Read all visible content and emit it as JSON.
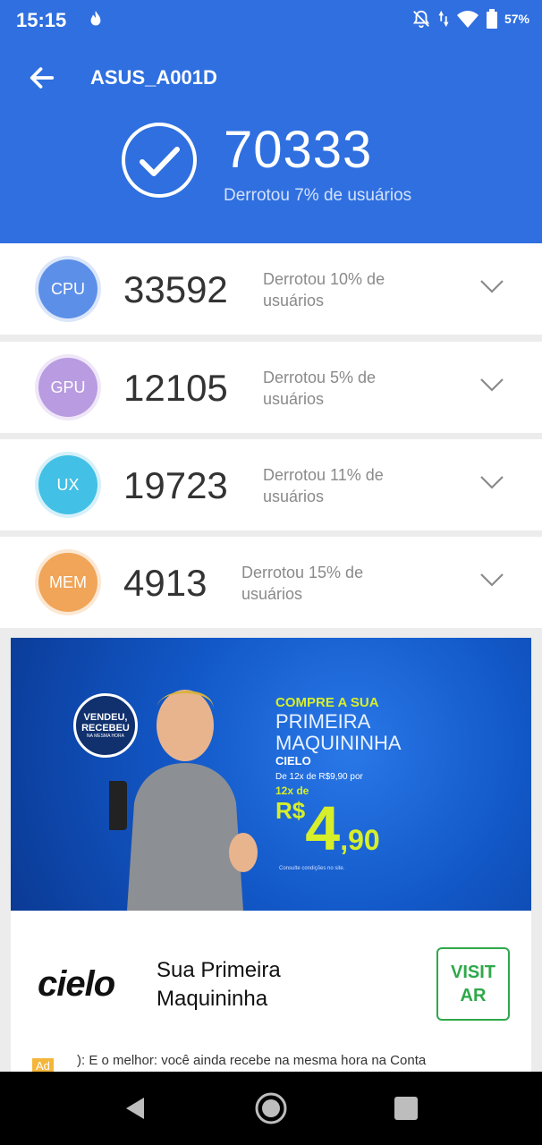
{
  "status_bar": {
    "time": "15:15",
    "battery": "57%"
  },
  "header": {
    "title": "ASUS_A001D",
    "total_score": "70333",
    "total_subtitle": "Derrotou 7% de usuários"
  },
  "scores": [
    {
      "label": "CPU",
      "score": "33592",
      "desc": "Derrotou 10% de usuários",
      "color": "#5c8fe8"
    },
    {
      "label": "GPU",
      "score": "12105",
      "desc": "Derrotou 5% de usuários",
      "color": "#b89be0"
    },
    {
      "label": "UX",
      "score": "19723",
      "desc": "Derrotou 11% de usuários",
      "color": "#42c0e6"
    },
    {
      "label": "MEM",
      "score": "4913",
      "desc": "Derrotou 15% de usuários",
      "color": "#f0a558"
    }
  ],
  "ad": {
    "banner_seal": "VENDEU, RECEBEU",
    "banner_seal_sub": "NA MESMA HORA",
    "banner_line1": "COMPRE A SUA",
    "banner_line2": "PRIMEIRA MAQUININHA",
    "banner_line3": "CIELO",
    "banner_line4": "De 12x de R$9,90 por",
    "banner_line5": "12x de",
    "price_currency": "R$",
    "price_main": "4",
    "price_cents": ",90",
    "banner_fine": "Consulte condições no site.",
    "logo": "cielo",
    "title": "Sua Primeira Maquininha",
    "cta": "VISIT AR",
    "tag": "Ad",
    "body": "): E o melhor: você ainda recebe na mesma hora na Conta"
  },
  "icons": [
    "flame-icon",
    "bell-off-icon",
    "data-arrows-icon",
    "wifi-icon",
    "battery-icon",
    "back-arrow-icon",
    "check-icon",
    "chevron-down-icon",
    "nav-back-icon",
    "nav-home-icon",
    "nav-recent-icon"
  ]
}
